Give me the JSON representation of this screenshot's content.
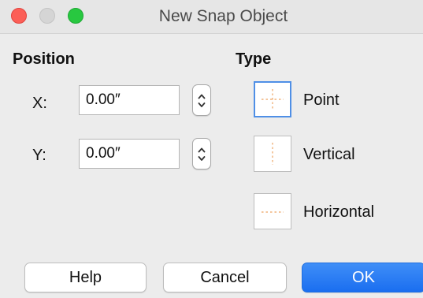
{
  "window": {
    "title": "New Snap Object"
  },
  "position": {
    "heading": "Position",
    "x_label": "X:",
    "x_value": "0.00″",
    "y_label": "Y:",
    "y_value": "0.00″"
  },
  "type": {
    "heading": "Type",
    "options": [
      {
        "label": "Point",
        "selected": true,
        "icon": "snap-point-icon"
      },
      {
        "label": "Vertical",
        "selected": false,
        "icon": "snap-vertical-icon"
      },
      {
        "label": "Horizontal",
        "selected": false,
        "icon": "snap-horizontal-icon"
      }
    ]
  },
  "buttons": {
    "help": "Help",
    "cancel": "Cancel",
    "ok": "OK"
  },
  "colors": {
    "close": "#fc5f57",
    "minimize_disabled": "#d5d5d5",
    "maximize": "#28c840",
    "accent": "#1a6ef0",
    "guide_orange": "#f0b27a",
    "selection_blue": "#4f8fe6"
  }
}
